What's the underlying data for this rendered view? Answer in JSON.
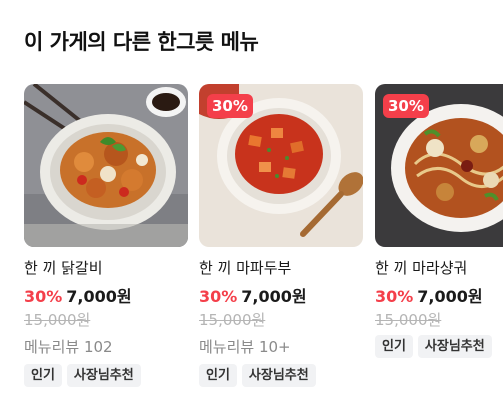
{
  "section": {
    "title": "이 가게의 다른 한그릇 메뉴"
  },
  "items": [
    {
      "name": "한 끼 닭갈비",
      "discount_rate": "30%",
      "price": "7,000원",
      "original_price": "15,000원",
      "review": "메뉴리뷰 102",
      "badge": "",
      "tags": [
        "인기",
        "사장님추천"
      ]
    },
    {
      "name": "한 끼 마파두부",
      "discount_rate": "30%",
      "price": "7,000원",
      "original_price": "15,000원",
      "review": "메뉴리뷰 10+",
      "badge": "30%",
      "tags": [
        "인기",
        "사장님추천"
      ]
    },
    {
      "name": "한 끼 마라샹궈",
      "discount_rate": "30%",
      "price": "7,000원",
      "original_price": "15,000원",
      "review": "",
      "badge": "30%",
      "tags": [
        "인기",
        "사장님추천"
      ]
    }
  ],
  "colors": {
    "accent": "#f43f4a",
    "muted": "#8a8a8a",
    "strike": "#b5b5b5",
    "tag_bg": "#f1f2f4"
  }
}
